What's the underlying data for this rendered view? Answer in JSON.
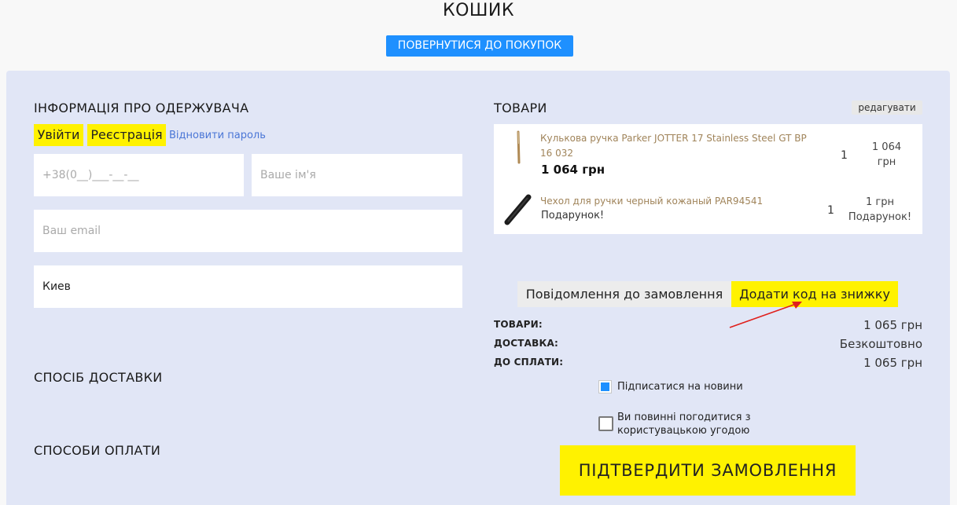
{
  "header": {
    "title": "КОШИК",
    "back_label": "ПОВЕРНУТИСЯ ДО ПОКУПОК"
  },
  "recipient": {
    "heading": "ІНФОРМАЦІЯ ПРО ОДЕРЖУВАЧА",
    "login_label": "Увійти",
    "register_label": "Реєстрація",
    "restore_label": "Відновити пароль",
    "phone_placeholder": "+38(0__)___-__-__",
    "name_placeholder": "Ваше ім'я",
    "email_placeholder": "Ваш email",
    "city_value": "Киев"
  },
  "delivery": {
    "heading": "СПОСІБ ДОСТАВКИ"
  },
  "payment": {
    "heading": "СПОСОБИ ОПЛАТИ"
  },
  "cart": {
    "heading": "ТОВАРИ",
    "edit_label": "редагувати",
    "items": [
      {
        "name_line1": "Кулькова ручка Parker JOTTER 17 Stainless Steel GT BP",
        "name_line2": "16 032",
        "price": "1 064 грн",
        "qty": "1",
        "sum_line1": "1 064",
        "sum_line2": "грн",
        "image_icon": "pen-icon"
      },
      {
        "name": "Чехол для ручки черный кожаный PAR94541",
        "note": "Подарунок!",
        "qty": "1",
        "sum_line1": "1 грн",
        "sum_line2": "Подарунок!",
        "image_icon": "pen-case-icon"
      }
    ]
  },
  "order_tabs": {
    "comment_label": "Повідомлення до замовлення",
    "discount_label": "Додати код на знижку"
  },
  "totals": {
    "goods_label": "ТОВАРИ:",
    "goods_value": "1 065 грн",
    "delivery_label": "ДОСТАВКА:",
    "delivery_value": "Безкоштовно",
    "pay_label": "ДО СПЛАТИ:",
    "pay_value": "1 065 грн"
  },
  "options": {
    "subscribe_label": "Підписатися на новини",
    "subscribe_checked": true,
    "agree_line1": "Ви повинні погодитися з",
    "agree_line2": "користувацькою угодою",
    "agree_checked": false
  },
  "confirm_label": "ПІДТВЕРДИТИ ЗАМОВЛЕННЯ",
  "colors": {
    "accent_blue": "#1e90ff",
    "highlight_yellow": "#fff200",
    "panel_bg": "#e1e6f6",
    "annotation_arrow": "#e0201c"
  }
}
